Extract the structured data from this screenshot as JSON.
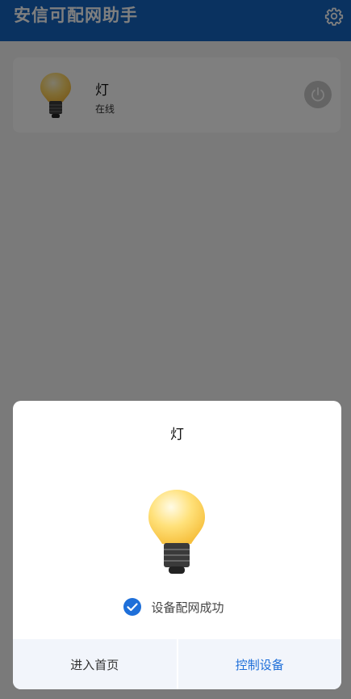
{
  "header": {
    "title": "安信可配网助手",
    "settings_icon": "gear-icon"
  },
  "device_card": {
    "name": "灯",
    "status": "在线",
    "icon": "lightbulb-icon",
    "power_icon": "power-icon"
  },
  "dialog": {
    "device_name": "灯",
    "icon": "lightbulb-icon",
    "success_icon": "checkmark-circle-icon",
    "success_message": "设备配网成功",
    "home_button": "进入首页",
    "control_button": "控制设备"
  },
  "colors": {
    "header_bg": "#1565c0",
    "accent": "#1e6fd9",
    "overlay": "rgba(0,0,0,0.5)"
  }
}
